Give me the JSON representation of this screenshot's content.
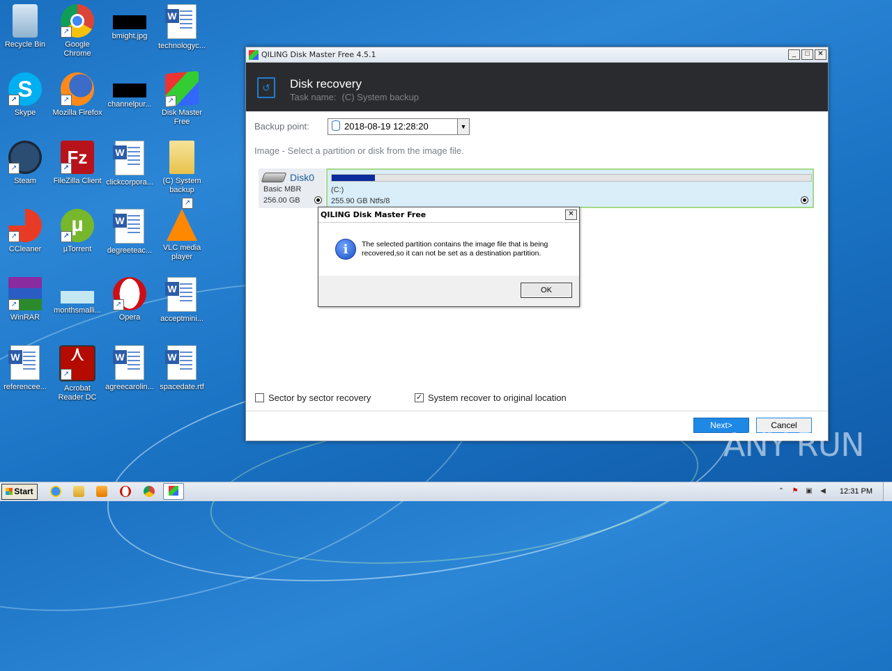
{
  "desktop": {
    "icons": [
      {
        "label": "Recycle Bin",
        "icon": "recycle-bin-icon"
      },
      {
        "label": "Google Chrome",
        "icon": "chrome-icon"
      },
      {
        "label": "bmight.jpg",
        "icon": "image-file-icon"
      },
      {
        "label": "technologyc...",
        "icon": "word-doc-icon"
      },
      {
        "label": "Skype",
        "icon": "skype-icon"
      },
      {
        "label": "Mozilla Firefox",
        "icon": "firefox-icon"
      },
      {
        "label": "channelpur...",
        "icon": "image-file-icon"
      },
      {
        "label": "Disk Master Free",
        "icon": "disk-master-icon"
      },
      {
        "label": "Steam",
        "icon": "steam-icon"
      },
      {
        "label": "FileZilla Client",
        "icon": "filezilla-icon"
      },
      {
        "label": "clickcorpora...",
        "icon": "word-doc-icon"
      },
      {
        "label": "(C) System backup",
        "icon": "folder-icon"
      },
      {
        "label": "CCleaner",
        "icon": "ccleaner-icon"
      },
      {
        "label": "µTorrent",
        "icon": "utorrent-icon"
      },
      {
        "label": "degreeteac...",
        "icon": "word-doc-icon"
      },
      {
        "label": "VLC media player",
        "icon": "vlc-icon"
      },
      {
        "label": "WinRAR",
        "icon": "winrar-icon"
      },
      {
        "label": "monthsmalli...",
        "icon": "image-file-icon"
      },
      {
        "label": "Opera",
        "icon": "opera-icon"
      },
      {
        "label": "acceptmini...",
        "icon": "word-doc-icon"
      },
      {
        "label": "referencee...",
        "icon": "word-doc-icon"
      },
      {
        "label": "Acrobat Reader DC",
        "icon": "acrobat-icon"
      },
      {
        "label": "agreecarolin...",
        "icon": "word-doc-icon"
      },
      {
        "label": "spacedate.rtf",
        "icon": "word-doc-icon"
      }
    ]
  },
  "window": {
    "title": "QILING Disk Master Free 4.5.1",
    "controls": {
      "minimize": "_",
      "maximize": "□",
      "close": "✕"
    },
    "header": {
      "title": "Disk recovery",
      "task_label": "Task name:",
      "task_name": "(C) System backup"
    },
    "backup_point": {
      "label": "Backup point:",
      "value": "2018-08-19 12:28:20"
    },
    "image_hint": "Image - Select a partition or disk from the image file.",
    "disk": {
      "name": "Disk0",
      "type": "Basic MBR",
      "size": "256.00 GB",
      "selected": true
    },
    "partition": {
      "name": "(C:)",
      "info": "255.90 GB Ntfs/8",
      "used_fraction": 0.09,
      "selected": true
    },
    "options": {
      "sector_by_sector": {
        "label": "Sector by sector recovery",
        "checked": false
      },
      "system_recover": {
        "label": "System recover to original location",
        "checked": true
      }
    },
    "buttons": {
      "next": "Next>",
      "cancel": "Cancel"
    }
  },
  "dialog": {
    "title": "QILING Disk Master Free",
    "close": "✕",
    "message": "The selected partition contains the image file that is being recovered,so it can not be set as a destination partition.",
    "ok": "OK"
  },
  "taskbar": {
    "start": "Start",
    "clock": "12:31 PM"
  },
  "watermark": "ANY RUN",
  "colors": {
    "header_bg": "#2a2b2e",
    "accent": "#1e88e5",
    "partition_bg": "#d9eef9",
    "partition_border": "#a3d88a",
    "usage_fill": "#0a2c9c"
  }
}
